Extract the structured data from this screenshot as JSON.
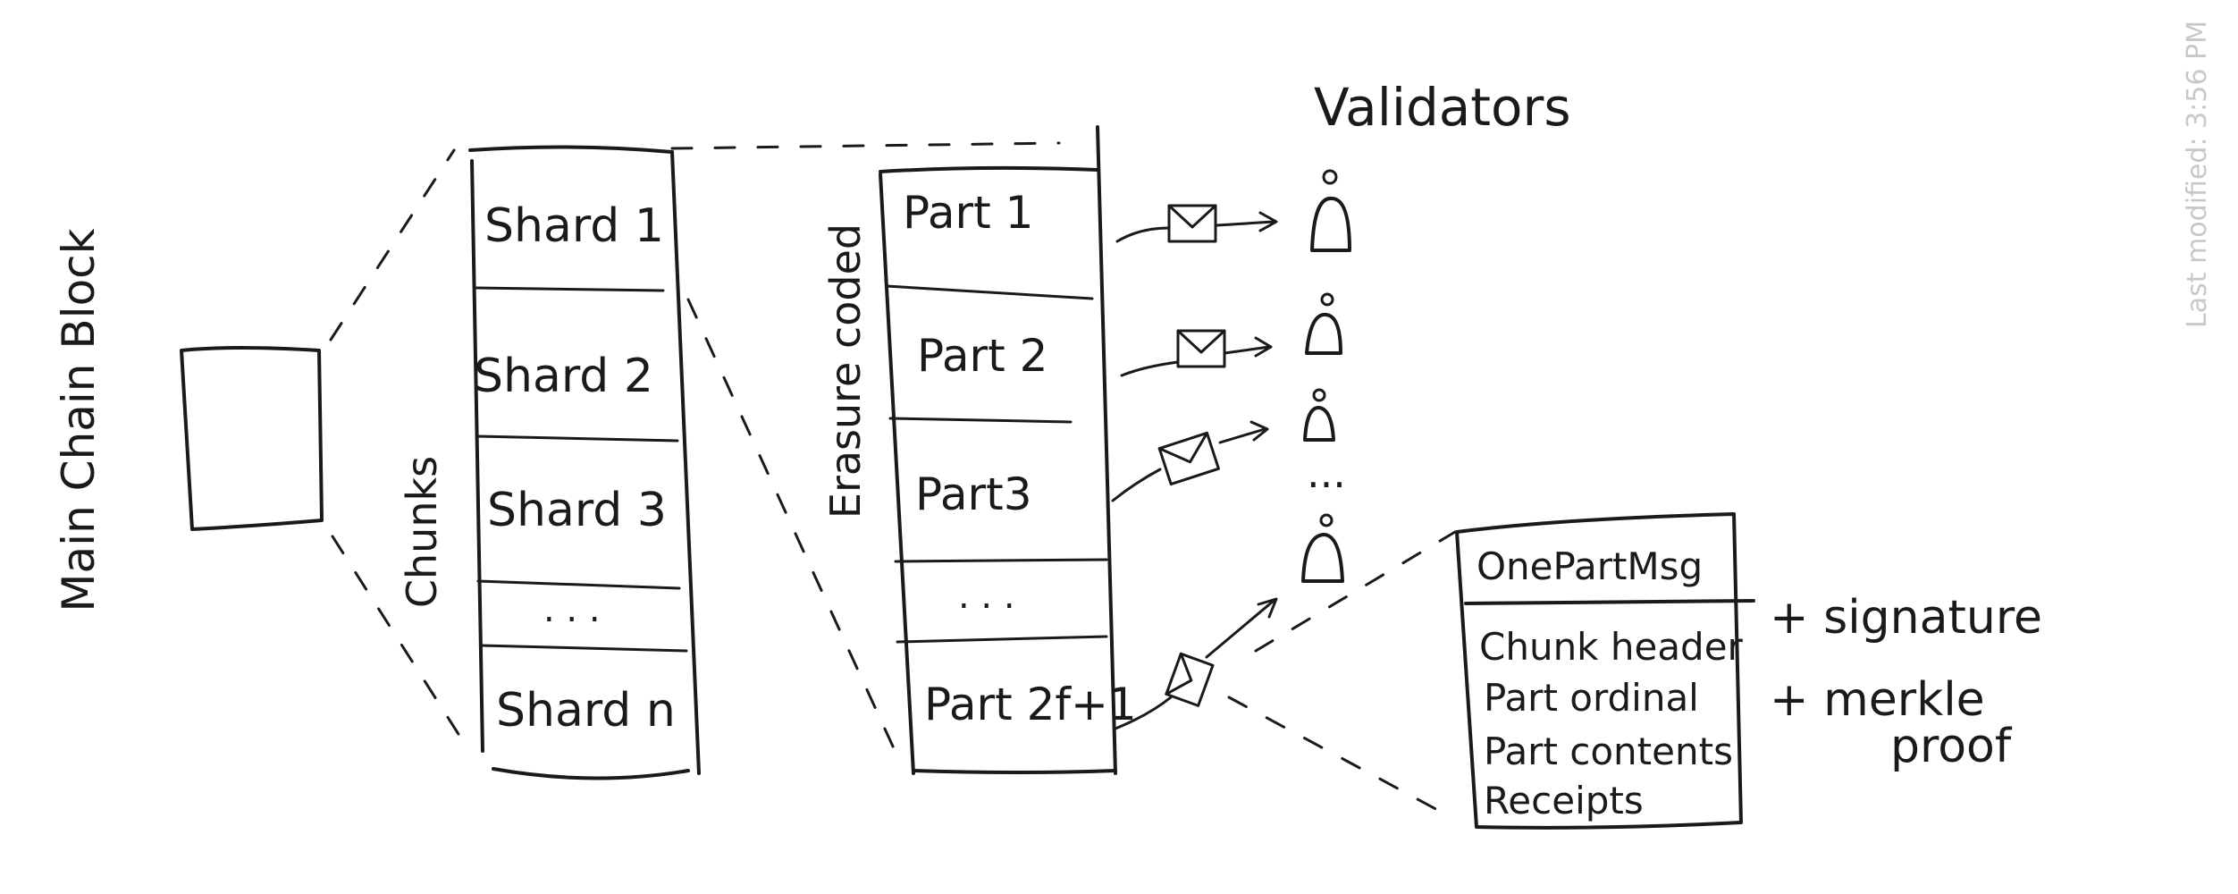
{
  "main_block_label": "Main Chain Block",
  "chunks_label": "Chunks",
  "shards": [
    "Shard 1",
    "Shard 2",
    "Shard 3",
    ". . .",
    "Shard n"
  ],
  "erasure_label": "Erasure coded",
  "parts": [
    "Part 1",
    "Part 2",
    "Part3",
    ". . .",
    "Part 2f+1"
  ],
  "validators_label": "Validators",
  "validator_ellipsis": "...",
  "message": {
    "title": "OnePartMsg",
    "fields": [
      "Chunk header",
      "Part ordinal",
      "Part contents",
      "Receipts"
    ],
    "annotations": [
      "+ signature",
      "+ merkle",
      "proof"
    ]
  },
  "last_modified": "Last modified: 3:56 PM"
}
